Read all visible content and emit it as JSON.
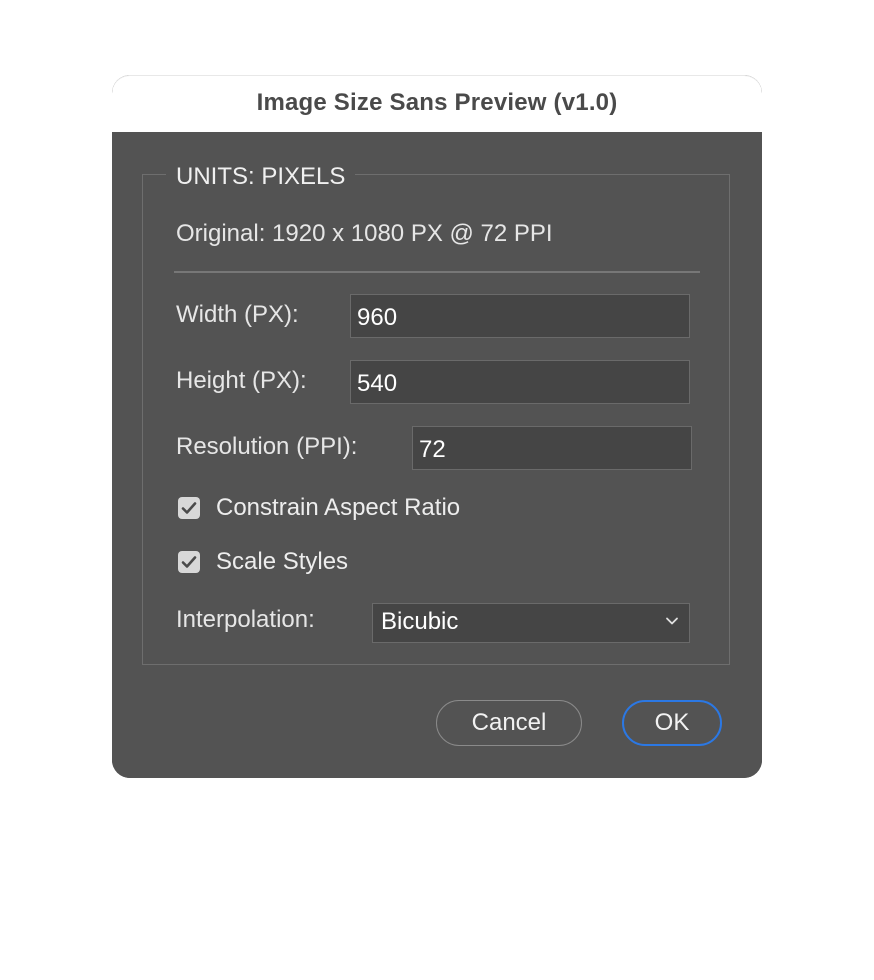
{
  "dialog": {
    "title": "Image Size Sans Preview (v1.0)",
    "units_legend": "UNITS: PIXELS",
    "original": "Original: 1920 x 1080 PX @ 72 PPI"
  },
  "fields": {
    "width_label": "Width (PX):",
    "width_value": "960",
    "height_label": "Height (PX):",
    "height_value": "540",
    "resolution_label": "Resolution (PPI):",
    "resolution_value": "72"
  },
  "options": {
    "constrain_label": "Constrain Aspect Ratio",
    "constrain_checked": true,
    "scale_styles_label": "Scale Styles",
    "scale_styles_checked": true,
    "interpolation_label": "Interpolation:",
    "interpolation_value": "Bicubic"
  },
  "buttons": {
    "cancel_label": "Cancel",
    "ok_label": "OK"
  },
  "colors": {
    "panel": "#535353",
    "accent": "#2b78e4"
  }
}
